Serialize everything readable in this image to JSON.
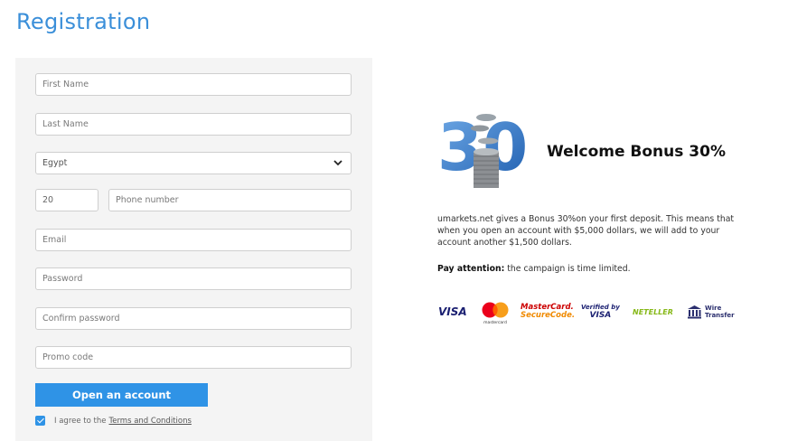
{
  "page": {
    "title": "Registration"
  },
  "form": {
    "first_name_placeholder": "First Name",
    "last_name_placeholder": "Last Name",
    "country_value": "Egypt",
    "phone_code_value": "20",
    "phone_placeholder": "Phone number",
    "email_placeholder": "Email",
    "password_placeholder": "Password",
    "confirm_password_placeholder": "Confirm password",
    "promo_placeholder": "Promo code",
    "submit_label": "Open an account",
    "agree_text": "I agree to the",
    "terms_link": "Terms and Conditions",
    "agree_checked": true
  },
  "promo": {
    "image_text": "30",
    "heading": "Welcome Bonus 30%",
    "description": "umarkets.net gives a Bonus 30%on your first deposit. This means that when you open an account with $5,000 dollars, we will add to your account another $1,500 dollars.",
    "attention_label": "Pay attention:",
    "attention_text": " the campaign is time limited."
  },
  "payments": {
    "visa": "VISA",
    "mastercard_small": "mastercard",
    "securecode_line1": "MasterCard.",
    "securecode_line2": "SecureCode.",
    "verified_line1": "Verified by",
    "verified_line2": "VISA",
    "neteller": "NETELLER",
    "wire_line1": "Wire",
    "wire_line2": "Transfer"
  },
  "colors": {
    "accent": "#2f93e6",
    "title": "#3b8fd9",
    "panel_bg": "#f4f4f4"
  }
}
